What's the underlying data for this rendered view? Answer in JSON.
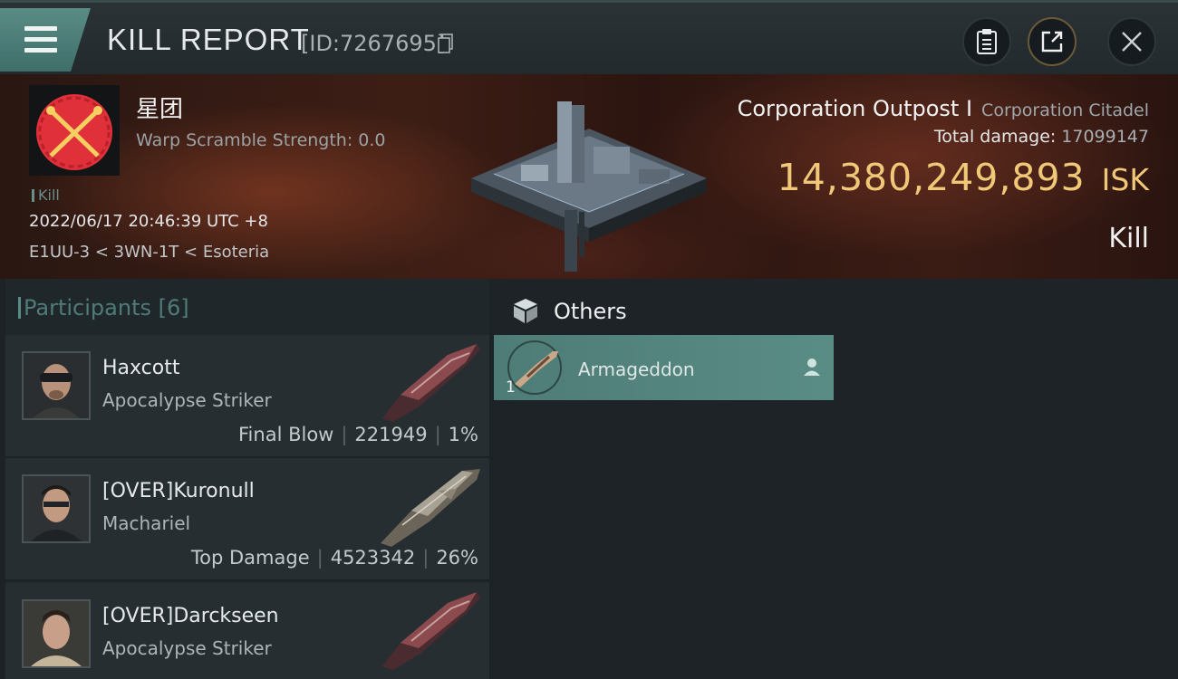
{
  "header": {
    "title": "KILL REPORT",
    "report_id": "[ID:7267695]",
    "icons": [
      "menu-icon",
      "copy-icon",
      "clipboard-icon",
      "share-icon",
      "close-icon"
    ]
  },
  "victim": {
    "name": "星团",
    "scramble": "Warp Scramble Strength: 0.0",
    "tag": "Kill",
    "datetime": "2022/06/17 20:46:39 UTC +8",
    "location": "E1UU-3 < 3WN-1T < Esoteria",
    "ship_name": "Corporation Outpost I",
    "ship_class": "Corporation Citadel",
    "total_damage_label": "Total damage:",
    "total_damage": "17099147",
    "isk_value": "14,380,249,893",
    "isk_unit": "ISK",
    "result": "Kill"
  },
  "participants": {
    "heading": "Participants [6]",
    "items": [
      {
        "name": "Haxcott",
        "ship": "Apocalypse Striker",
        "role": "Final Blow",
        "damage": "221949",
        "percent": "1%"
      },
      {
        "name": "[OVER]Kuronull",
        "ship": "Machariel",
        "role": "Top Damage",
        "damage": "4523342",
        "percent": "26%"
      },
      {
        "name": "[OVER]Darckseen",
        "ship": "Apocalypse Striker",
        "role": "",
        "damage": "",
        "percent": ""
      }
    ]
  },
  "others": {
    "heading": "Others",
    "items": [
      {
        "name": "Armageddon",
        "count": "1"
      }
    ]
  },
  "colors": {
    "accent": "#5a8c86",
    "isk": "#f0c878",
    "corp_logo": "#e0303a"
  }
}
